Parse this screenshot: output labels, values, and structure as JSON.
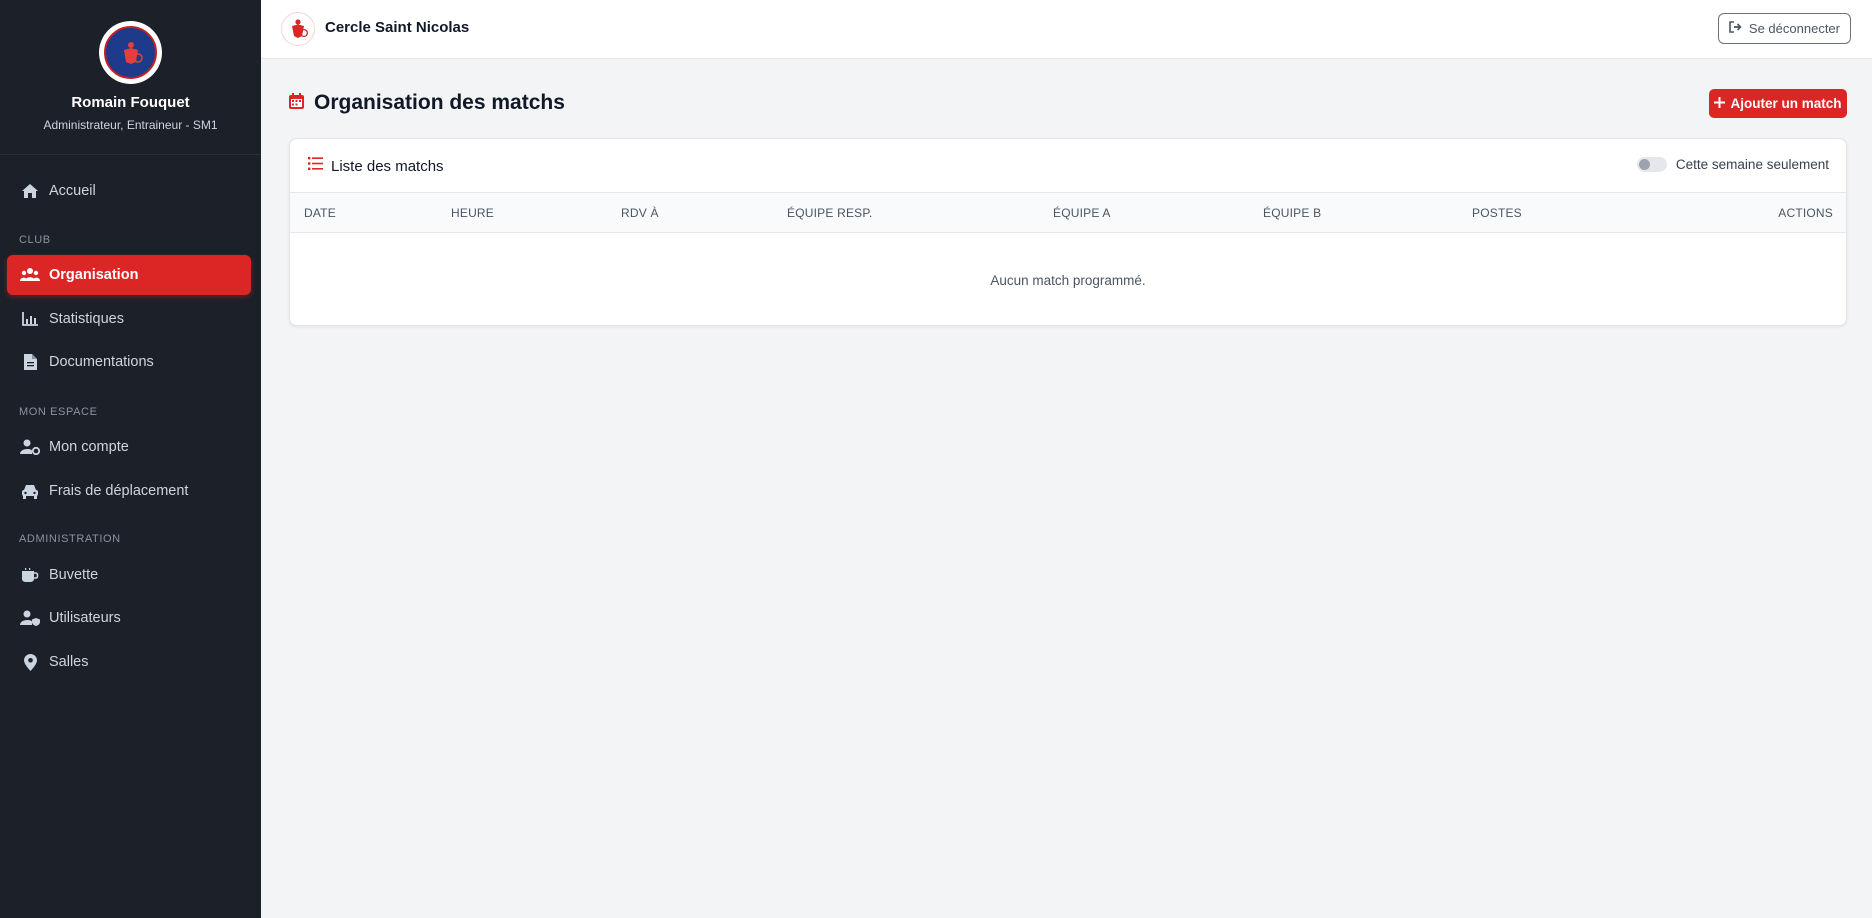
{
  "colors": {
    "sidebar_bg": "#1b2029",
    "accent": "#dc2626",
    "page_bg": "#f3f4f6"
  },
  "profile": {
    "name": "Romain Fouquet",
    "role": "Administrateur, Entraineur - SM1",
    "avatar_icon": "club-logo-icon"
  },
  "sidebar": {
    "items": [
      {
        "label": "Accueil",
        "icon": "home-icon"
      },
      {
        "label": "Organisation",
        "icon": "users-icon",
        "active": true
      },
      {
        "label": "Statistiques",
        "icon": "chart-icon"
      },
      {
        "label": "Documentations",
        "icon": "file-icon"
      },
      {
        "label": "Mon compte",
        "icon": "user-gear-icon"
      },
      {
        "label": "Frais de déplacement",
        "icon": "car-icon"
      },
      {
        "label": "Buvette",
        "icon": "mug-icon"
      },
      {
        "label": "Utilisateurs",
        "icon": "user-shield-icon"
      },
      {
        "label": "Salles",
        "icon": "map-pin-icon"
      }
    ],
    "sections": [
      "CLUB",
      "MON ESPACE",
      "ADMINISTRATION"
    ]
  },
  "topbar": {
    "brand": "Cercle Saint Nicolas",
    "logout_label": "Se déconnecter"
  },
  "main": {
    "title": "Organisation des matchs",
    "add_button": "Ajouter un match",
    "card": {
      "title": "Liste des matchs",
      "toggle_label": "Cette semaine seulement",
      "toggle_on": false,
      "columns": [
        "DATE",
        "HEURE",
        "RDV À",
        "ÉQUIPE RESP.",
        "ÉQUIPE A",
        "ÉQUIPE B",
        "POSTES",
        "ACTIONS"
      ],
      "empty_text": "Aucun match programmé."
    }
  }
}
